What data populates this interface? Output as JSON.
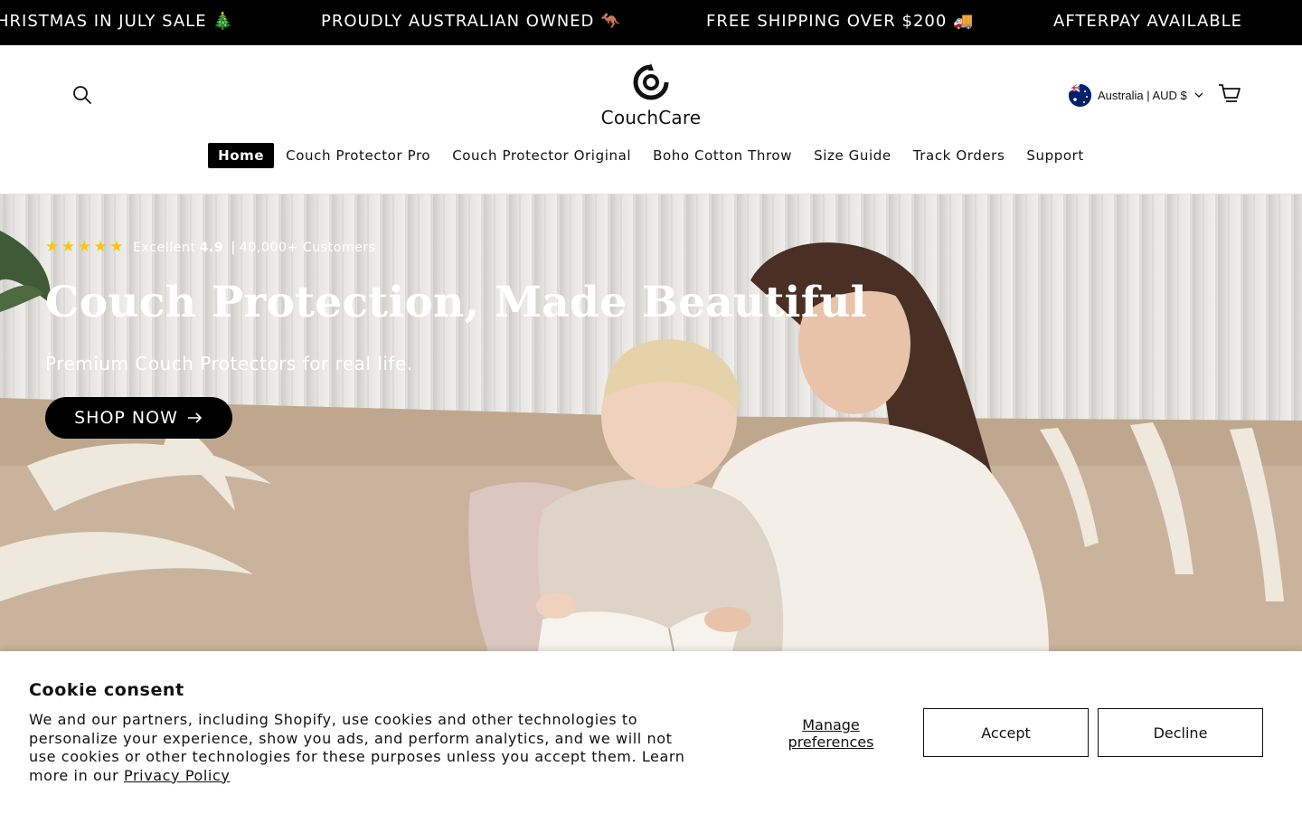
{
  "announcement": {
    "messages": [
      "HRISTMAS IN JULY SALE 🎄",
      "PROUDLY AUSTRALIAN OWNED 🦘",
      "FREE SHIPPING OVER $200 🚚",
      "AFTERPAY AVAILABLE"
    ]
  },
  "header": {
    "brand": "CouchCare",
    "locale_label": "Australia | AUD $",
    "nav": [
      {
        "label": "Home",
        "active": true
      },
      {
        "label": "Couch Protector Pro"
      },
      {
        "label": "Couch Protector Original"
      },
      {
        "label": "Boho Cotton Throw"
      },
      {
        "label": "Size Guide"
      },
      {
        "label": "Track Orders"
      },
      {
        "label": "Support"
      }
    ]
  },
  "hero": {
    "rating_label": "Excellent",
    "rating_value": "4.9",
    "rating_separator": "|",
    "rating_customers": "40,000+ Customers",
    "stars": 5,
    "title": "Couch Protection, Made Beautiful",
    "subtitle": "Premium Couch Protectors for real life.",
    "cta": "SHOP NOW"
  },
  "cookie": {
    "title": "Cookie consent",
    "body": "We and our partners, including Shopify, use cookies and other technologies to personalize your experience, show you ads, and perform analytics, and we will not use cookies or other technologies for these purposes unless you accept them. Learn more in our",
    "policy_link": "Privacy Policy",
    "manage": "Manage preferences",
    "accept": "Accept",
    "decline": "Decline"
  },
  "colors": {
    "announcement_bg": "#000000",
    "star": "#f5c518",
    "button_dark": "#000000"
  }
}
